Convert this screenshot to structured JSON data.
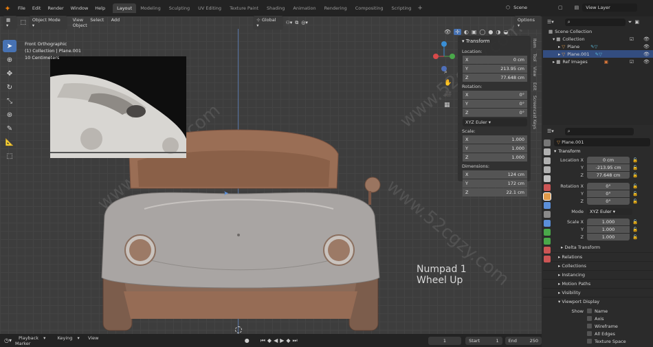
{
  "topbar": {
    "menus": [
      "File",
      "Edit",
      "Render",
      "Window",
      "Help"
    ],
    "workspaces": [
      "Layout",
      "Modeling",
      "Sculpting",
      "UV Editing",
      "Texture Paint",
      "Shading",
      "Animation",
      "Rendering",
      "Compositing",
      "Scripting"
    ],
    "active_workspace": "Layout",
    "scene": "Scene",
    "view_layer": "View Layer"
  },
  "viewport_header": {
    "mode": "Object Mode",
    "menus": [
      "View",
      "Select",
      "Add",
      "Object"
    ],
    "orientation": "Global",
    "options": "Options"
  },
  "viewport": {
    "info_lines": [
      "Front Orthographic",
      "(1) Collection | Plane.001",
      "10 Centimeters"
    ],
    "overlay_text": [
      "Numpad 1",
      "Wheel Up"
    ],
    "watermark": "www.52cgzy.com"
  },
  "npanel": {
    "title": "Transform",
    "location_label": "Location:",
    "location": [
      {
        "axis": "X",
        "value": "0 cm"
      },
      {
        "axis": "Y",
        "value": "213.95 cm"
      },
      {
        "axis": "Z",
        "value": "77.648 cm"
      }
    ],
    "rotation_label": "Rotation:",
    "rotation": [
      {
        "axis": "X",
        "value": "0°"
      },
      {
        "axis": "Y",
        "value": "0°"
      },
      {
        "axis": "Z",
        "value": "0°"
      }
    ],
    "rotation_mode": "XYZ Euler",
    "scale_label": "Scale:",
    "scale": [
      {
        "axis": "X",
        "value": "1.000"
      },
      {
        "axis": "Y",
        "value": "1.000"
      },
      {
        "axis": "Z",
        "value": "1.000"
      }
    ],
    "dimensions_label": "Dimensions:",
    "dimensions": [
      {
        "axis": "X",
        "value": "124 cm"
      },
      {
        "axis": "Y",
        "value": "172 cm"
      },
      {
        "axis": "Z",
        "value": "22.1 cm"
      }
    ],
    "tabs": [
      "Item",
      "Tool",
      "View",
      "Edit",
      "Screencast Keys"
    ]
  },
  "outliner": {
    "rows": [
      {
        "label": "Scene Collection",
        "indent": 0
      },
      {
        "label": "Collection",
        "indent": 1
      },
      {
        "label": "Plane",
        "indent": 2
      },
      {
        "label": "Plane.001",
        "indent": 2
      },
      {
        "label": "Ref Images",
        "indent": 1
      }
    ]
  },
  "properties": {
    "object_name": "Plane.001",
    "transform_title": "Transform",
    "location_label": "Location X",
    "location": [
      "0 cm",
      "-213.95 cm",
      "77.648 cm"
    ],
    "rotation_label": "Rotation X",
    "rotation": [
      "0°",
      "0°",
      "0°"
    ],
    "mode_label": "Mode",
    "mode": "XYZ Euler",
    "scale_label": "Scale X",
    "scale": [
      "1.000",
      "1.000",
      "1.000"
    ],
    "axis_y": "Y",
    "axis_z": "Z",
    "delta": "Delta Transform",
    "sections": [
      "Relations",
      "Collections",
      "Instancing",
      "Motion Paths",
      "Visibility",
      "Viewport Display"
    ],
    "show_label": "Show",
    "show_items": [
      "Name",
      "Axis",
      "Wireframe",
      "All Edges",
      "Texture Space"
    ]
  },
  "timeline": {
    "menus": [
      "Playback",
      "Keying",
      "View",
      "Marker"
    ],
    "current_frame": "1",
    "start_label": "Start",
    "start": "1",
    "end_label": "End",
    "end": "250"
  },
  "colors": {
    "accent": "#4772b3",
    "body_mesh": "#a89e96",
    "ref_shape": "#9a6e55"
  }
}
